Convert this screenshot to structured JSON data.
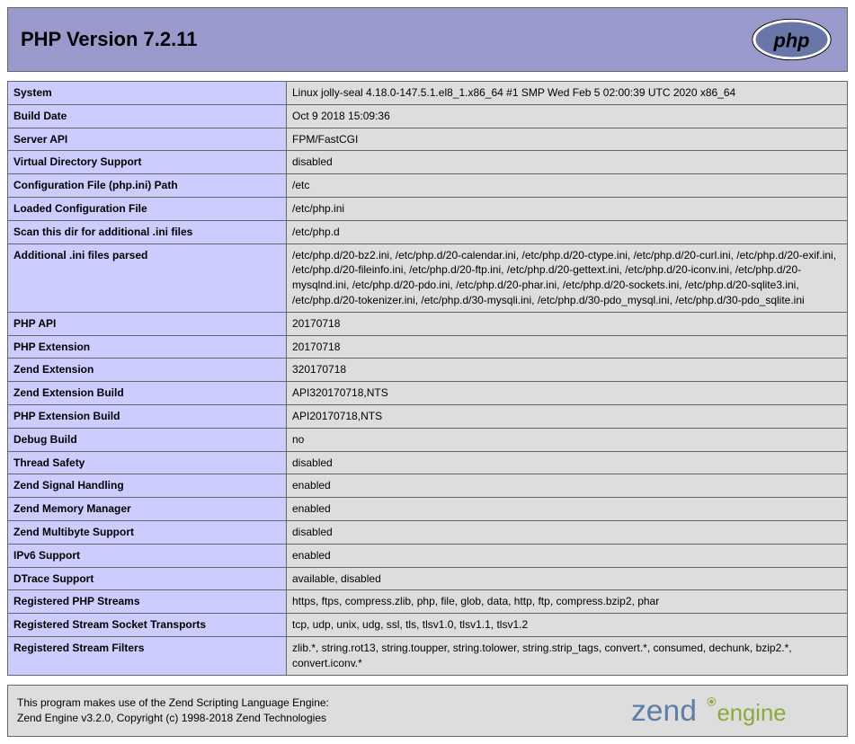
{
  "header": {
    "title": "PHP Version 7.2.11"
  },
  "rows": [
    {
      "label": "System",
      "value": "Linux jolly-seal 4.18.0-147.5.1.el8_1.x86_64 #1 SMP Wed Feb 5 02:00:39 UTC 2020 x86_64"
    },
    {
      "label": "Build Date",
      "value": "Oct 9 2018 15:09:36"
    },
    {
      "label": "Server API",
      "value": "FPM/FastCGI"
    },
    {
      "label": "Virtual Directory Support",
      "value": "disabled"
    },
    {
      "label": "Configuration File (php.ini) Path",
      "value": "/etc"
    },
    {
      "label": "Loaded Configuration File",
      "value": "/etc/php.ini"
    },
    {
      "label": "Scan this dir for additional .ini files",
      "value": "/etc/php.d"
    },
    {
      "label": "Additional .ini files parsed",
      "value": "/etc/php.d/20-bz2.ini, /etc/php.d/20-calendar.ini, /etc/php.d/20-ctype.ini, /etc/php.d/20-curl.ini, /etc/php.d/20-exif.ini, /etc/php.d/20-fileinfo.ini, /etc/php.d/20-ftp.ini, /etc/php.d/20-gettext.ini, /etc/php.d/20-iconv.ini, /etc/php.d/20-mysqlnd.ini, /etc/php.d/20-pdo.ini, /etc/php.d/20-phar.ini, /etc/php.d/20-sockets.ini, /etc/php.d/20-sqlite3.ini, /etc/php.d/20-tokenizer.ini, /etc/php.d/30-mysqli.ini, /etc/php.d/30-pdo_mysql.ini, /etc/php.d/30-pdo_sqlite.ini"
    },
    {
      "label": "PHP API",
      "value": "20170718"
    },
    {
      "label": "PHP Extension",
      "value": "20170718"
    },
    {
      "label": "Zend Extension",
      "value": "320170718"
    },
    {
      "label": "Zend Extension Build",
      "value": "API320170718,NTS"
    },
    {
      "label": "PHP Extension Build",
      "value": "API20170718,NTS"
    },
    {
      "label": "Debug Build",
      "value": "no"
    },
    {
      "label": "Thread Safety",
      "value": "disabled"
    },
    {
      "label": "Zend Signal Handling",
      "value": "enabled"
    },
    {
      "label": "Zend Memory Manager",
      "value": "enabled"
    },
    {
      "label": "Zend Multibyte Support",
      "value": "disabled"
    },
    {
      "label": "IPv6 Support",
      "value": "enabled"
    },
    {
      "label": "DTrace Support",
      "value": "available, disabled"
    },
    {
      "label": "Registered PHP Streams",
      "value": "https, ftps, compress.zlib, php, file, glob, data, http, ftp, compress.bzip2, phar"
    },
    {
      "label": "Registered Stream Socket Transports",
      "value": "tcp, udp, unix, udg, ssl, tls, tlsv1.0, tlsv1.1, tlsv1.2"
    },
    {
      "label": "Registered Stream Filters",
      "value": "zlib.*, string.rot13, string.toupper, string.tolower, string.strip_tags, convert.*, consumed, dechunk, bzip2.*, convert.iconv.*"
    }
  ],
  "zend": {
    "line1": "This program makes use of the Zend Scripting Language Engine:",
    "line2": "Zend Engine v3.2.0, Copyright (c) 1998-2018 Zend Technologies"
  }
}
